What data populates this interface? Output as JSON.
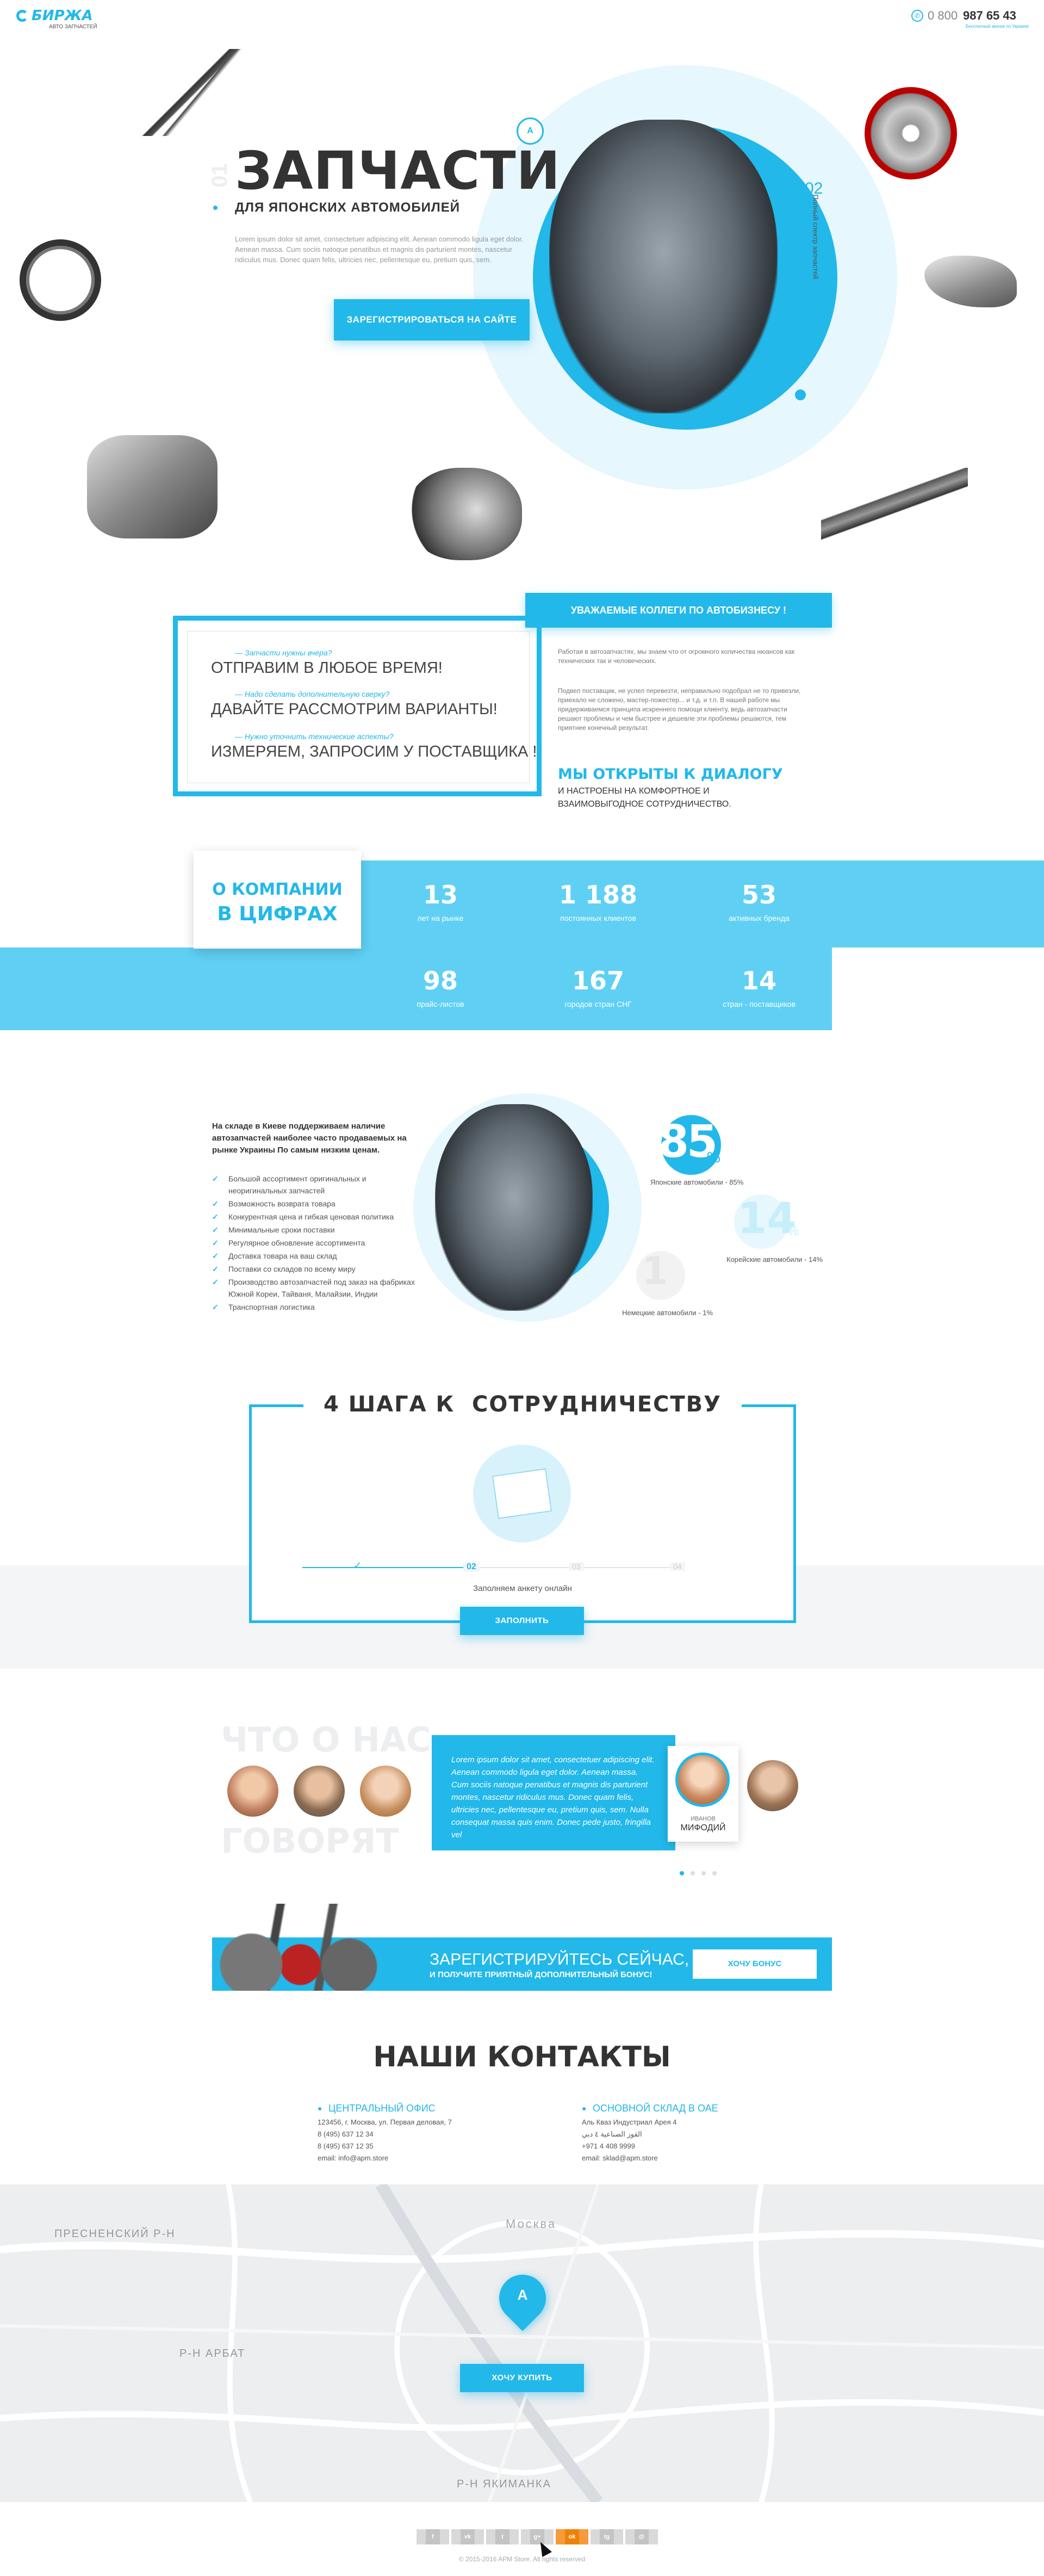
{
  "header": {
    "logo": "БИРЖА",
    "logo_sub": "АВТО ЗАПЧАСТЕЙ",
    "phone_prefix": "0 800",
    "phone_main": "987 65 43",
    "phone_note": "Бесплатный звонок по Украине"
  },
  "hero": {
    "side_number": "01",
    "title": "ЗАПЧАСТИ",
    "subtitle": "ДЛЯ ЯПОНСКИХ АВТОМОБИЛЕЙ",
    "text": "Lorem ipsum dolor sit amet, consectetuer adipiscing elit. Aenean commodo ligula eget dolor. Aenean massa. Cum sociis natoque penatibus et magnis dis parturient montes, nascetur ridiculus mus. Donec quam felis, ultricies nec, pellentesque eu, pretium quis, sem.",
    "cta": "ЗАРЕГИСТРИРОВАТЬСЯ НА САЙТЕ",
    "slide_number": "02",
    "vertical_text": "Полный спектр запчастей"
  },
  "offer": {
    "q1": "— Запчасти нужны вчера?",
    "a1": "ОТПРАВИМ В ЛЮБОЕ ВРЕМЯ!",
    "q2": "— Надо сделать дополнительную сверку?",
    "a2": "ДАВАЙТЕ РАССМОТРИМ ВАРИАНТЫ!",
    "q3": "— Нужно уточнить технические аспекты?",
    "a3": "ИЗМЕРЯЕМ, ЗАПРОСИМ У ПОСТАВЩИКА !",
    "banner": "УВАЖАЕМЫЕ КОЛЛЕГИ ПО АВТОБИЗНЕСУ !",
    "p1": "Работая в автозапчастях, мы знаем что от огромного количества нюансов как технических так и человеческих.",
    "p2": "Подвел поставщик, не успел перевезти, неправильно подобрал не то привезли, приехало не сложено, мастер-пожестер... и т.д. и т.п. В нашей работе мы придерживаемся принципа искреннего помощи клиенту, ведь автозапчасти решают проблемы и чем быстрее и дешевле эти проблемы решаются, тем приятнее конечный результат.",
    "headline": "МЫ ОТКРЫТЫ К ДИАЛОГУ",
    "tail1": "И НАСТРОЕНЫ НА КОМФОРТНОЕ И",
    "tail2": "ВЗАИМОВЫГОДНОЕ СОТРУДНИЧЕСТВО."
  },
  "about": {
    "label1": "О КОМПАНИИ",
    "label2": "В ЦИФРАХ",
    "stats": [
      {
        "n": "13",
        "l": "лет на рынке"
      },
      {
        "n": "1 188",
        "l": "постоянных клиентов"
      },
      {
        "n": "53",
        "l": "активных бренда"
      },
      {
        "n": "98",
        "l": "прайс-листов"
      },
      {
        "n": "167",
        "l": "городов стран СНГ"
      },
      {
        "n": "14",
        "l": "стран - поставщиков"
      }
    ]
  },
  "stock": {
    "intro": "На складе в Киеве поддерживаем наличие автозапчастей наиболее часто продаваемых на рынке Украины По самым низким ценам.",
    "items": [
      "Большой ассортимент оригинальных и",
      "неоригинальных запчастей",
      "Возможность возврата товара",
      "Конкурентная цена и гибкая ценовая политика",
      "Минимальные сроки поставки",
      "Регулярное обновление ассортимента",
      "Доставка товара на ваш склад",
      "Поставки со складов по всему миру",
      "Производство автозапчастей под заказ на фабриках",
      "Южной Кореи, Тайваня, Малайзии, Индии",
      "Транспортная логистика"
    ],
    "pct1": "85",
    "lbl1": "Японские автомобили - 85%",
    "pct2": "14",
    "lbl2": "Корейские автомобили - 14%",
    "pct3": "1",
    "lbl3": "Немецкие автомобили - 1%"
  },
  "steps": {
    "title": "4 ШАГА К  СОТРУДНИЧЕСТВУ",
    "s1": "✓",
    "s2": "02",
    "s3": "03",
    "s4": "04",
    "caption": "Заполняем анкету онлайн",
    "button": "ЗАПОЛНИТЬ"
  },
  "reviews": {
    "t1": "ЧТО О НАС",
    "t2": "ГОВОРЯТ",
    "quote": "Lorem ipsum dolor sit amet, consectetuer adipiscing elit. Aenean commodo ligula eget dolor. Aenean massa. Cum sociis natoque penatibus et magnis dis parturient montes, nascetur ridiculus mus. Donec quam felis, ultricies nec, pellentesque eu, pretium quis, sem. Nulla consequat massa quis enim. Donec pede justo, fringilla vel",
    "name1": "ИВАНОВ",
    "name2": "МИФОДИЙ"
  },
  "cta": {
    "line1": "ЗАРЕГИСТРИРУЙТЕСЬ СЕЙЧАС,",
    "line2": "И ПОЛУЧИТЕ ПРИЯТНЫЙ ДОПОЛНИТЕЛЬНЫЙ БОНУС!",
    "button": "ХОЧУ БОНУС"
  },
  "contacts": {
    "title": "НАШИ КОНТАКТЫ",
    "o_title": "ЦЕНТРАЛЬНЫЙ ОФИС",
    "o1": "123456, г. Москва, ул. Первая деловая, 7",
    "o2": "8 (495) 637 12 34",
    "o3": "8 (495) 637 12 35",
    "o4": "email: info@apm.store",
    "w_title": "ОСНОВНОЙ СКЛАД В ОАЕ",
    "w1": "Аль Кваз Индустриал Арея 4",
    "w2": "القوز الصناعية ٤ دبي",
    "w3": "+971 4 408 9999",
    "w4": "email: sklad@apm.store"
  },
  "map": {
    "l1": "ПРЕСНЕНСКИЙ Р-Н",
    "l2": "Р-Н АРБАТ",
    "l3": "Москва",
    "l4": "Р-Н ЯКИМАНКА",
    "button": "ХОЧУ КУПИТЬ"
  },
  "footer": {
    "copy": "© 2015-2016 APM Store. All rights reserved",
    "shares": [
      "f",
      "vk",
      "t",
      "g+",
      "ok",
      "tg",
      "@"
    ]
  }
}
